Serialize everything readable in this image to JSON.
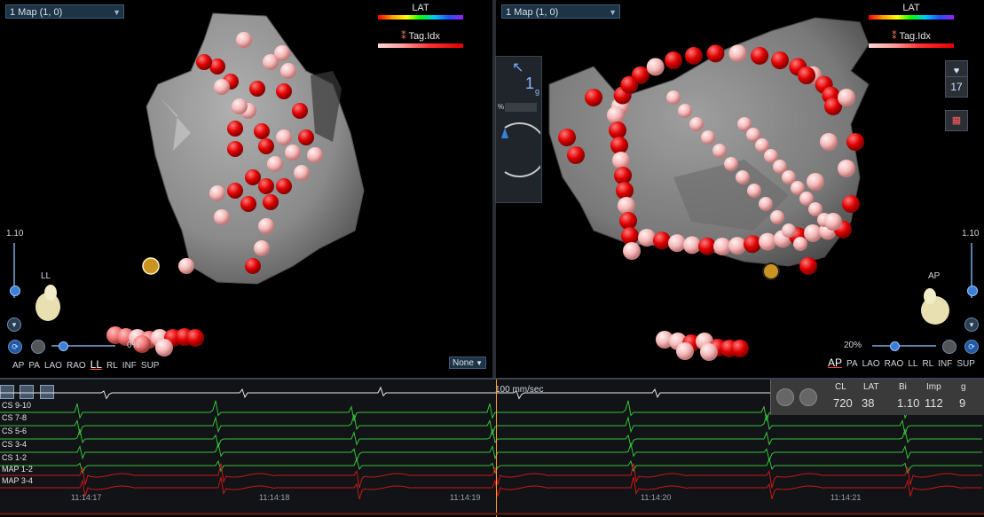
{
  "left_view": {
    "map_select": "1 Map (1, 0)",
    "lat_label": "LAT",
    "tag_label": "Tag.Idx",
    "zoom_value": "1.10",
    "orientation_label": "LL",
    "transparency": "0%",
    "view_buttons": [
      "AP",
      "PA",
      "LAO",
      "RAO",
      "LL",
      "RL",
      "INF",
      "SUP"
    ],
    "active_view": "LL",
    "none_select": "None"
  },
  "right_view": {
    "map_select": "1 Map (1, 0)",
    "lat_label": "LAT",
    "tag_label": "Tag.Idx",
    "zoom_value": "1.10",
    "orientation_label": "AP",
    "transparency": "20%",
    "view_buttons": [
      "AP",
      "PA",
      "LAO",
      "RAO",
      "LL",
      "RL",
      "INF",
      "SUP"
    ],
    "active_view": "AP",
    "side_panel_value": "1",
    "side_panel_unit": "g",
    "side_panel_pct": "%",
    "mini_count": "17"
  },
  "ecg": {
    "speed": "100 mm/sec",
    "channels": [
      "CS 9-10",
      "CS 7-8",
      "CS 5-6",
      "CS 3-4",
      "CS 1-2",
      "MAP 1-2",
      "MAP 3-4"
    ],
    "times": [
      "11:14:17",
      "11:14:18",
      "11:14:19",
      "11:14:20",
      "11:14:21"
    ],
    "measurements": {
      "headers": [
        "CL",
        "LAT",
        "Bi",
        "Imp",
        "g"
      ],
      "values": [
        "720",
        "38",
        "1.10",
        "112",
        "9"
      ]
    }
  },
  "colors": {
    "tag_dark": "#e00000",
    "tag_light": "#ffcccc",
    "chamber": "#8c8c8c",
    "cs_trace": "#35c23a",
    "map_trace": "#c81818",
    "surface_trace": "#e8e8e8",
    "cursor": "#ff9b2a"
  }
}
